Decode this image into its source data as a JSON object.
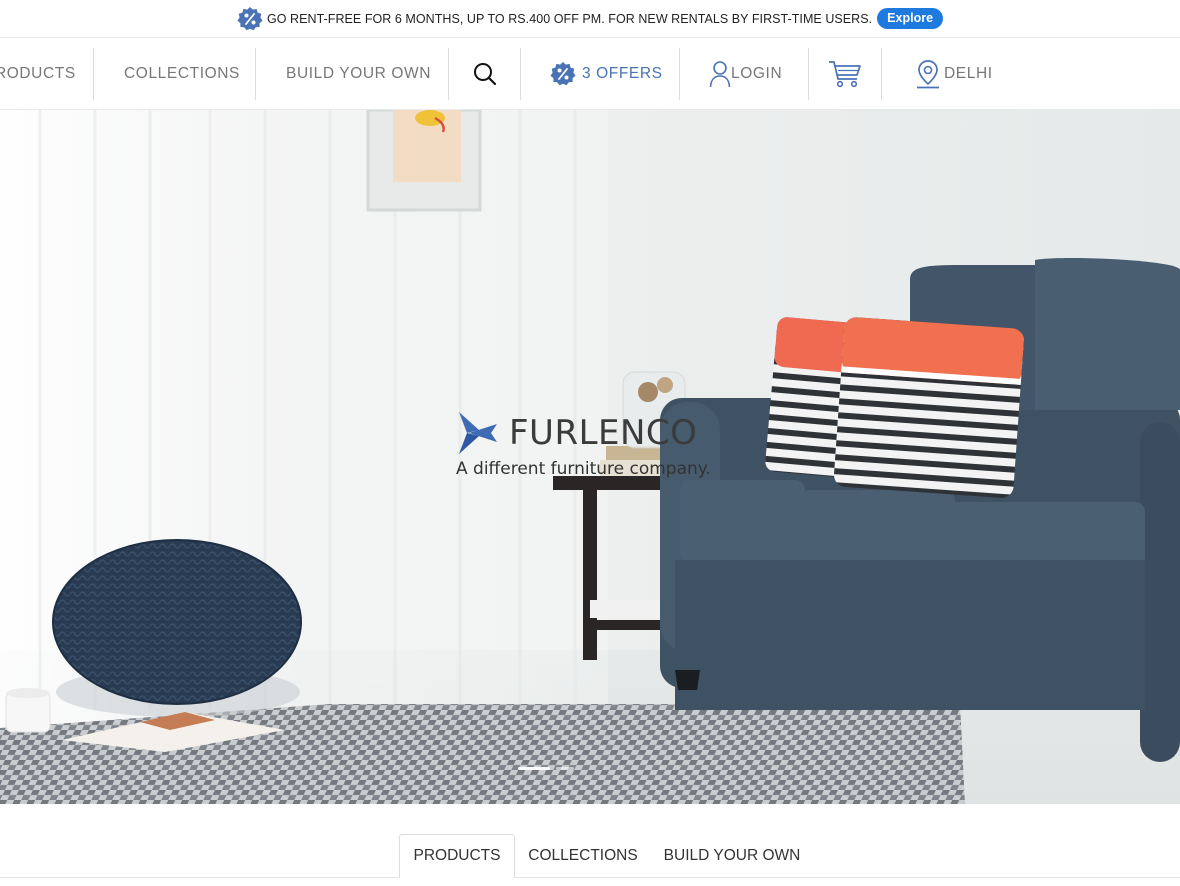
{
  "promo": {
    "text": "GO RENT-FREE FOR 6 MONTHS, UP TO RS.400 OFF PM. FOR NEW RENTALS BY FIRST-TIME USERS.",
    "button": "Explore",
    "badge_icon": "percent-badge-icon",
    "button_color": "#1f7ae0"
  },
  "nav": {
    "products": "PRODUCTS",
    "collections": "COLLECTIONS",
    "build": "BUILD YOUR OWN",
    "offers": "3 OFFERS",
    "login": "LOGIN",
    "location": "DELHI",
    "icons": [
      "search-icon",
      "percent-badge-icon",
      "user-icon",
      "cart-icon",
      "location-pin-icon"
    ],
    "accent_color": "#4a73b5"
  },
  "hero": {
    "brand": "FURLENCO",
    "tagline": "A different furniture company.",
    "slides": 2,
    "active_slide": 1
  },
  "tabs": {
    "items": [
      "PRODUCTS",
      "COLLECTIONS",
      "BUILD YOUR OWN"
    ],
    "active": "PRODUCTS"
  }
}
